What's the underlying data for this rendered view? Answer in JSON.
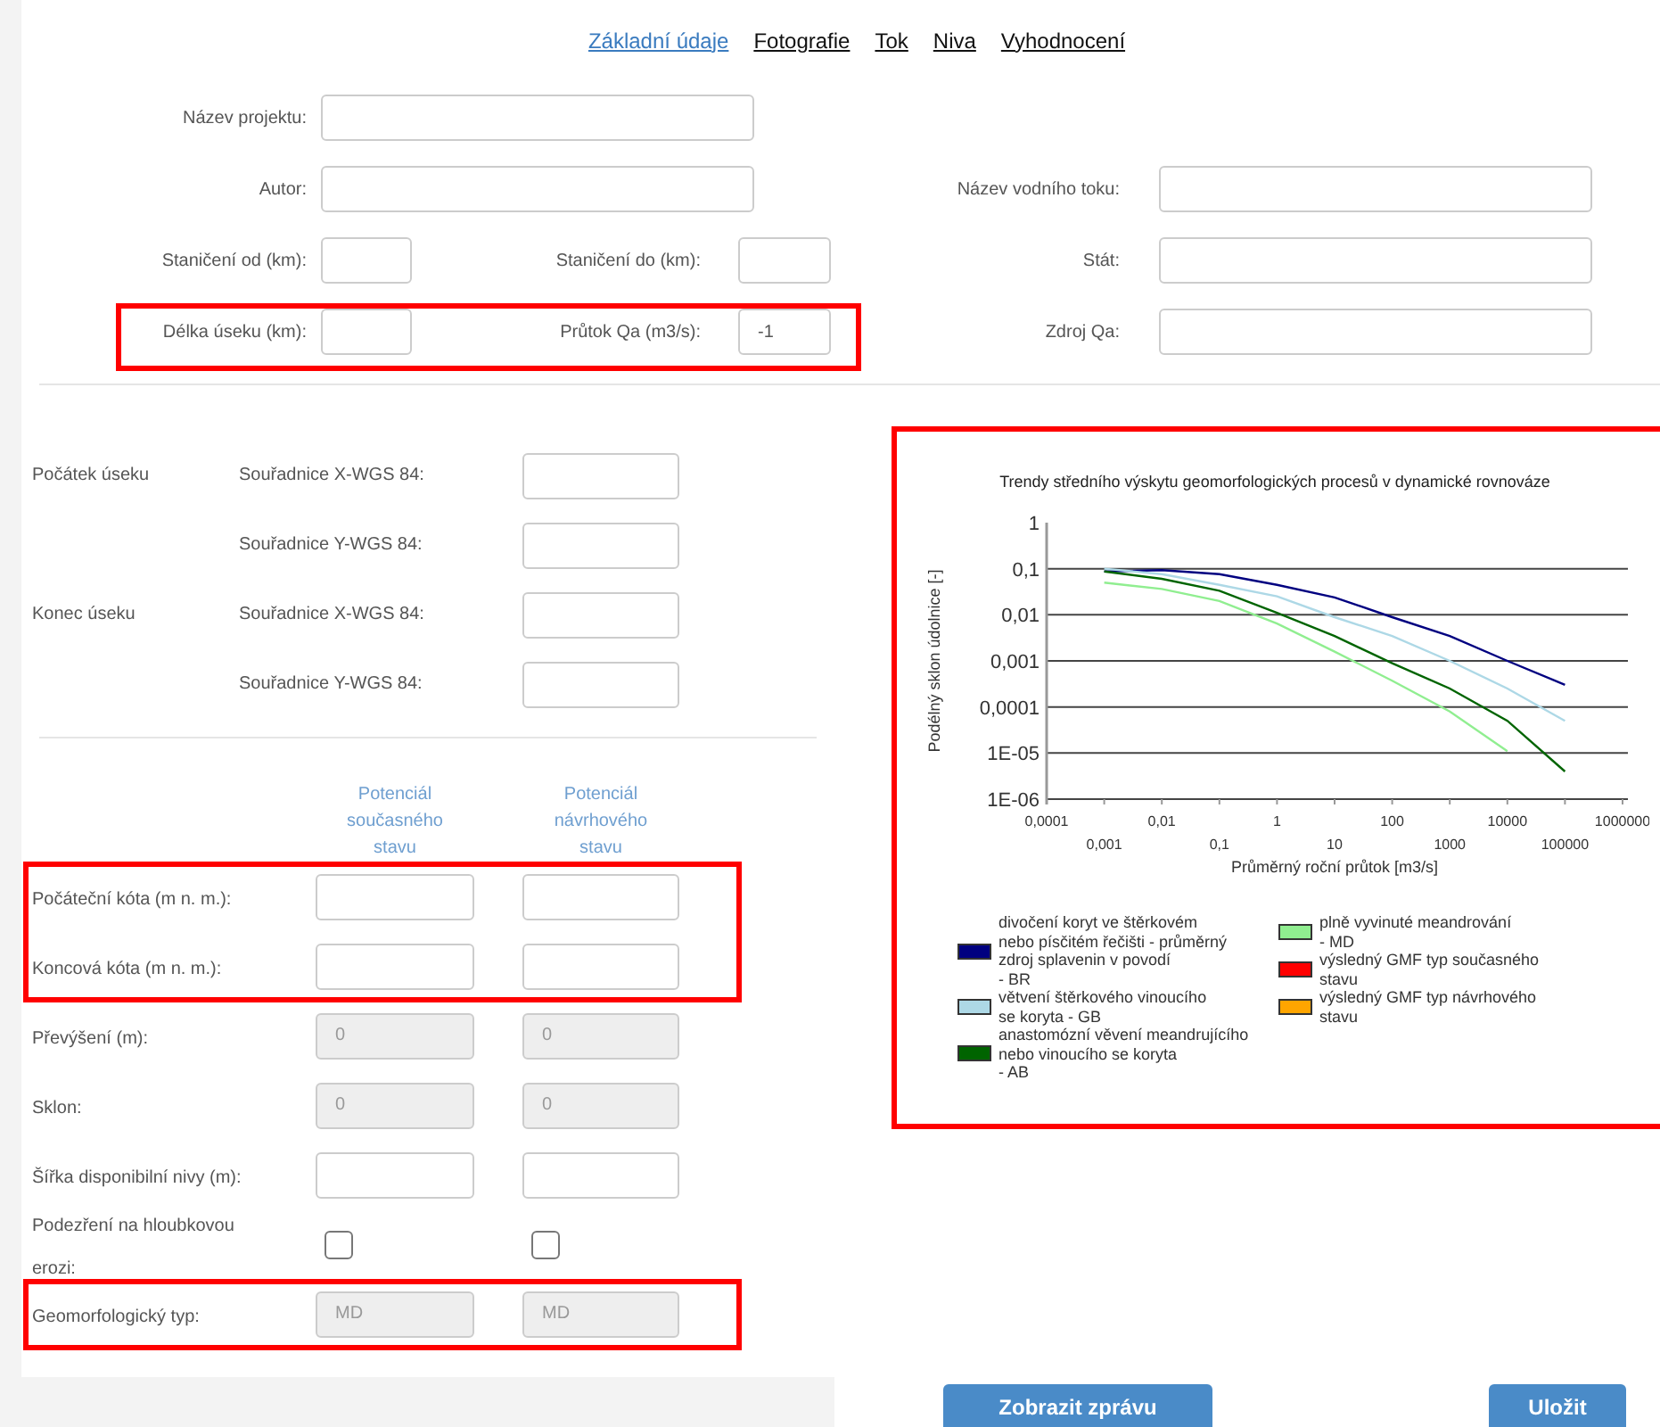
{
  "tabs": [
    {
      "label": "Základní údaje",
      "selected": true
    },
    {
      "label": "Fotografie",
      "selected": false
    },
    {
      "label": "Tok",
      "selected": false
    },
    {
      "label": "Niva",
      "selected": false
    },
    {
      "label": "Vyhodnocení",
      "selected": false
    }
  ],
  "project_form": {
    "rows": [
      {
        "fields": [
          {
            "label": "Název projektu:",
            "kind": "wide",
            "highlighted": false
          }
        ]
      },
      {
        "fields": [
          {
            "label": "Autor:",
            "kind": "wide",
            "highlighted": false
          },
          {
            "label": "Název vodního toku:",
            "kind": "wide",
            "highlighted": false
          }
        ]
      },
      {
        "fields": [
          {
            "label": "Staničení od (km):",
            "kind": "short",
            "highlighted": false
          },
          {
            "label": "Staničení do (km):",
            "kind": "short",
            "highlighted": false
          },
          {
            "label": "Stát:",
            "kind": "wide",
            "highlighted": false
          }
        ]
      },
      {
        "fields": [
          {
            "label": "Délka úseku (km):",
            "kind": "short",
            "highlighted": true
          },
          {
            "label": "Průtok Qa (m3/s):",
            "kind": "short",
            "value": "-1",
            "highlighted": true
          },
          {
            "label": "Zdroj Qa:",
            "kind": "wide",
            "highlighted": false
          }
        ]
      }
    ]
  },
  "coordinates": {
    "groups": [
      {
        "label": "Počátek úseku",
        "fields": [
          {
            "label": "Souřadnice X-WGS 84:"
          },
          {
            "label": "Souřadnice Y-WGS 84:"
          }
        ]
      },
      {
        "label": "Konec úseku",
        "fields": [
          {
            "label": "Souřadnice X-WGS 84:"
          },
          {
            "label": "Souřadnice Y-WGS 84:"
          }
        ]
      }
    ]
  },
  "potential_table": {
    "columns": [
      "Potenciál současného stavu",
      "Potenciál návrhového stavu"
    ],
    "rows": [
      {
        "label": "Počáteční kóta (m n. m.):",
        "kind": "input",
        "highlighted": true,
        "cells": [
          {
            "disabled": false
          },
          {
            "disabled": false
          }
        ]
      },
      {
        "label": "Koncová kóta (m n. m.):",
        "kind": "input",
        "highlighted": true,
        "cells": [
          {
            "disabled": false
          },
          {
            "disabled": false
          }
        ]
      },
      {
        "label": "Převýšení (m):",
        "kind": "input",
        "highlighted": false,
        "cells": [
          {
            "value": "0",
            "disabled": true
          },
          {
            "value": "0",
            "disabled": true
          }
        ]
      },
      {
        "label": "Sklon:",
        "kind": "input",
        "highlighted": false,
        "cells": [
          {
            "value": "0",
            "disabled": true
          },
          {
            "value": "0",
            "disabled": true
          }
        ]
      },
      {
        "label": "Šířka disponibilní nivy (m):",
        "kind": "input",
        "highlighted": false,
        "cells": [
          {
            "disabled": false
          },
          {
            "disabled": false
          }
        ]
      },
      {
        "label": "Podezření na hloubkovou erozi:",
        "kind": "checkbox",
        "highlighted": false,
        "cells": [
          {
            "checked": false
          },
          {
            "checked": false
          }
        ]
      },
      {
        "label": "Geomorfologický typ:",
        "kind": "input",
        "highlighted": true,
        "cells": [
          {
            "value": "MD",
            "disabled": true
          },
          {
            "value": "MD",
            "disabled": true
          }
        ]
      }
    ]
  },
  "chart": {
    "highlighted": true,
    "title": "Trendy středního výskytu geomorfologických procesů v dynamické rovnováze",
    "xlabel": "Průměrný roční průtok [m3/s]",
    "ylabel": "Podélný sklon údolnice [-]",
    "x_tick_labels": [
      "0,0001",
      "0,001",
      "0,01",
      "0,1",
      "1",
      "10",
      "100",
      "1000",
      "10000",
      "100000",
      "1000000"
    ],
    "y_tick_labels": [
      "1",
      "0,1",
      "0,01",
      "0,001",
      "0,0001",
      "1E-05",
      "1E-06"
    ],
    "legend": [
      {
        "label": "divočení koryt ve štěrkovém\nnebo písčitém řečišti - průměrný\nzdroj splavenin v povodí\n- BR",
        "color": "#000080"
      },
      {
        "label": "větvení štěrkového vinoucího\nse koryta - GB",
        "color": "#add8e6"
      },
      {
        "label": "anastomózní věvení meandrujícího\nnebo vinoucího se koryta\n- AB",
        "color": "#006400"
      },
      {
        "label": "plně vyvinuté meandrování\n- MD",
        "color": "#90ee90"
      },
      {
        "label": "výsledný GMF typ současného\nstavu",
        "color": "#ff0000"
      },
      {
        "label": "výsledný GMF typ návrhového\nstavu",
        "color": "#ffa500"
      }
    ]
  },
  "buttons": [
    {
      "label": "Zobrazit zprávu"
    },
    {
      "label": "Uložit"
    }
  ]
}
